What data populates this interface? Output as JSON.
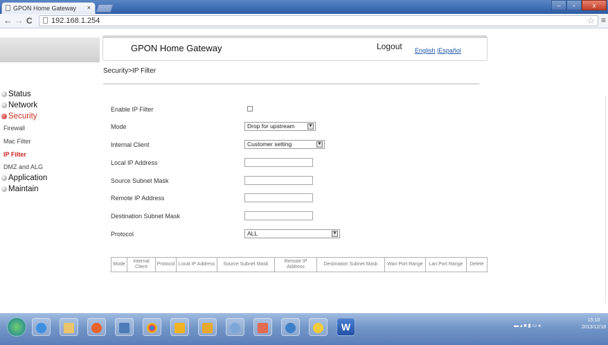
{
  "browser": {
    "tab_title": "GPON Home Gateway",
    "tab_close": "×",
    "url": "192.168.1.254",
    "back_glyph": "←",
    "forward_glyph": "→",
    "reload_glyph": "C",
    "star_glyph": "☆",
    "menu_glyph": "≡",
    "window_buttons": {
      "minimize": "–",
      "maximize": "▫",
      "close": "x"
    }
  },
  "header": {
    "brand": "GPON Home Gateway",
    "logout": "Logout",
    "lang_english": "English",
    "lang_sep": " |",
    "lang_spanish": "Español"
  },
  "breadcrumb": "Security>IP Filter",
  "sidebar": {
    "status": "Status",
    "network": "Network",
    "security": "Security",
    "security_items": [
      "Firewall",
      "Mac Filter",
      "IP Filter",
      "DMZ and ALG"
    ],
    "application": "Application",
    "maintain": "Maintain"
  },
  "form": {
    "enable_label": "Enable IP Filter",
    "mode_label": "Mode",
    "mode_value": "Drop for upstream",
    "internal_client_label": "Internal Client",
    "internal_client_value": "Customer setting",
    "local_ip_label": "Local IP Address",
    "source_mask_label": "Source Subnet Mask",
    "remote_ip_label": "Remote IP Address",
    "dest_mask_label": "Destination Subnet Mask",
    "protocol_label": "Protocol",
    "protocol_value": "ALL",
    "select_arrow": "▼"
  },
  "table": {
    "headers": [
      "Mode",
      "Internal Client",
      "Protocol",
      "Local IP Address",
      "Source Subnet Mask",
      "Remote IP Address",
      "Destination Subnet Mask",
      "Wan Port Range",
      "Lan Port Range",
      "Delete"
    ]
  },
  "taskbar": {
    "word_label": "W",
    "clock_time": "15:10",
    "clock_date": "2013/12/18"
  },
  "colors": {
    "accent_red": "#c4301c",
    "link_blue": "#1d55a8",
    "taskbar_blue": "#7396c8"
  }
}
